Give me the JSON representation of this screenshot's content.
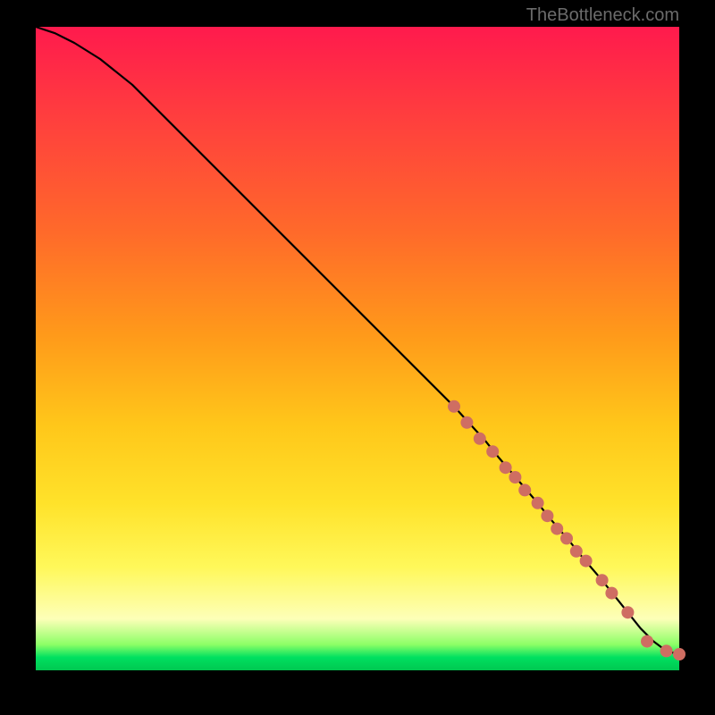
{
  "attribution_text": "TheBottleneck.com",
  "chart_data": {
    "type": "line",
    "title": "",
    "xlabel": "",
    "ylabel": "",
    "xlim": [
      0,
      100
    ],
    "ylim": [
      0,
      100
    ],
    "curve": {
      "x": [
        0,
        3,
        6,
        10,
        15,
        20,
        30,
        40,
        50,
        60,
        65,
        70,
        72,
        75,
        78,
        80,
        83,
        85,
        88,
        90,
        92,
        94,
        96,
        98,
        100
      ],
      "y": [
        100,
        99,
        97.5,
        95,
        91,
        86,
        76,
        66,
        56,
        46,
        41,
        35.5,
        33,
        29.5,
        26,
        23.5,
        20,
        17.5,
        14,
        11.5,
        9,
        6.5,
        4.5,
        3,
        2.5
      ]
    },
    "scatter": {
      "name": "highlighted-points",
      "color": "#cf6e62",
      "x": [
        65,
        67,
        69,
        71,
        73,
        74.5,
        76,
        78,
        79.5,
        81,
        82.5,
        84,
        85.5,
        88,
        89.5,
        92,
        95,
        98,
        100
      ],
      "y": [
        41,
        38.5,
        36,
        34,
        31.5,
        30,
        28,
        26,
        24,
        22,
        20.5,
        18.5,
        17,
        14,
        12,
        9,
        4.5,
        3,
        2.5
      ]
    },
    "gradient_stops": [
      {
        "pos": 0,
        "color": "#ff1a4d"
      },
      {
        "pos": 14,
        "color": "#ff3e3e"
      },
      {
        "pos": 32,
        "color": "#ff6a2a"
      },
      {
        "pos": 48,
        "color": "#ff9a1a"
      },
      {
        "pos": 62,
        "color": "#ffc71a"
      },
      {
        "pos": 74,
        "color": "#ffe22a"
      },
      {
        "pos": 84,
        "color": "#fff85a"
      },
      {
        "pos": 92,
        "color": "#fdffb8"
      },
      {
        "pos": 96,
        "color": "#8cff66"
      },
      {
        "pos": 98,
        "color": "#00e060"
      },
      {
        "pos": 100,
        "color": "#00c850"
      }
    ]
  }
}
